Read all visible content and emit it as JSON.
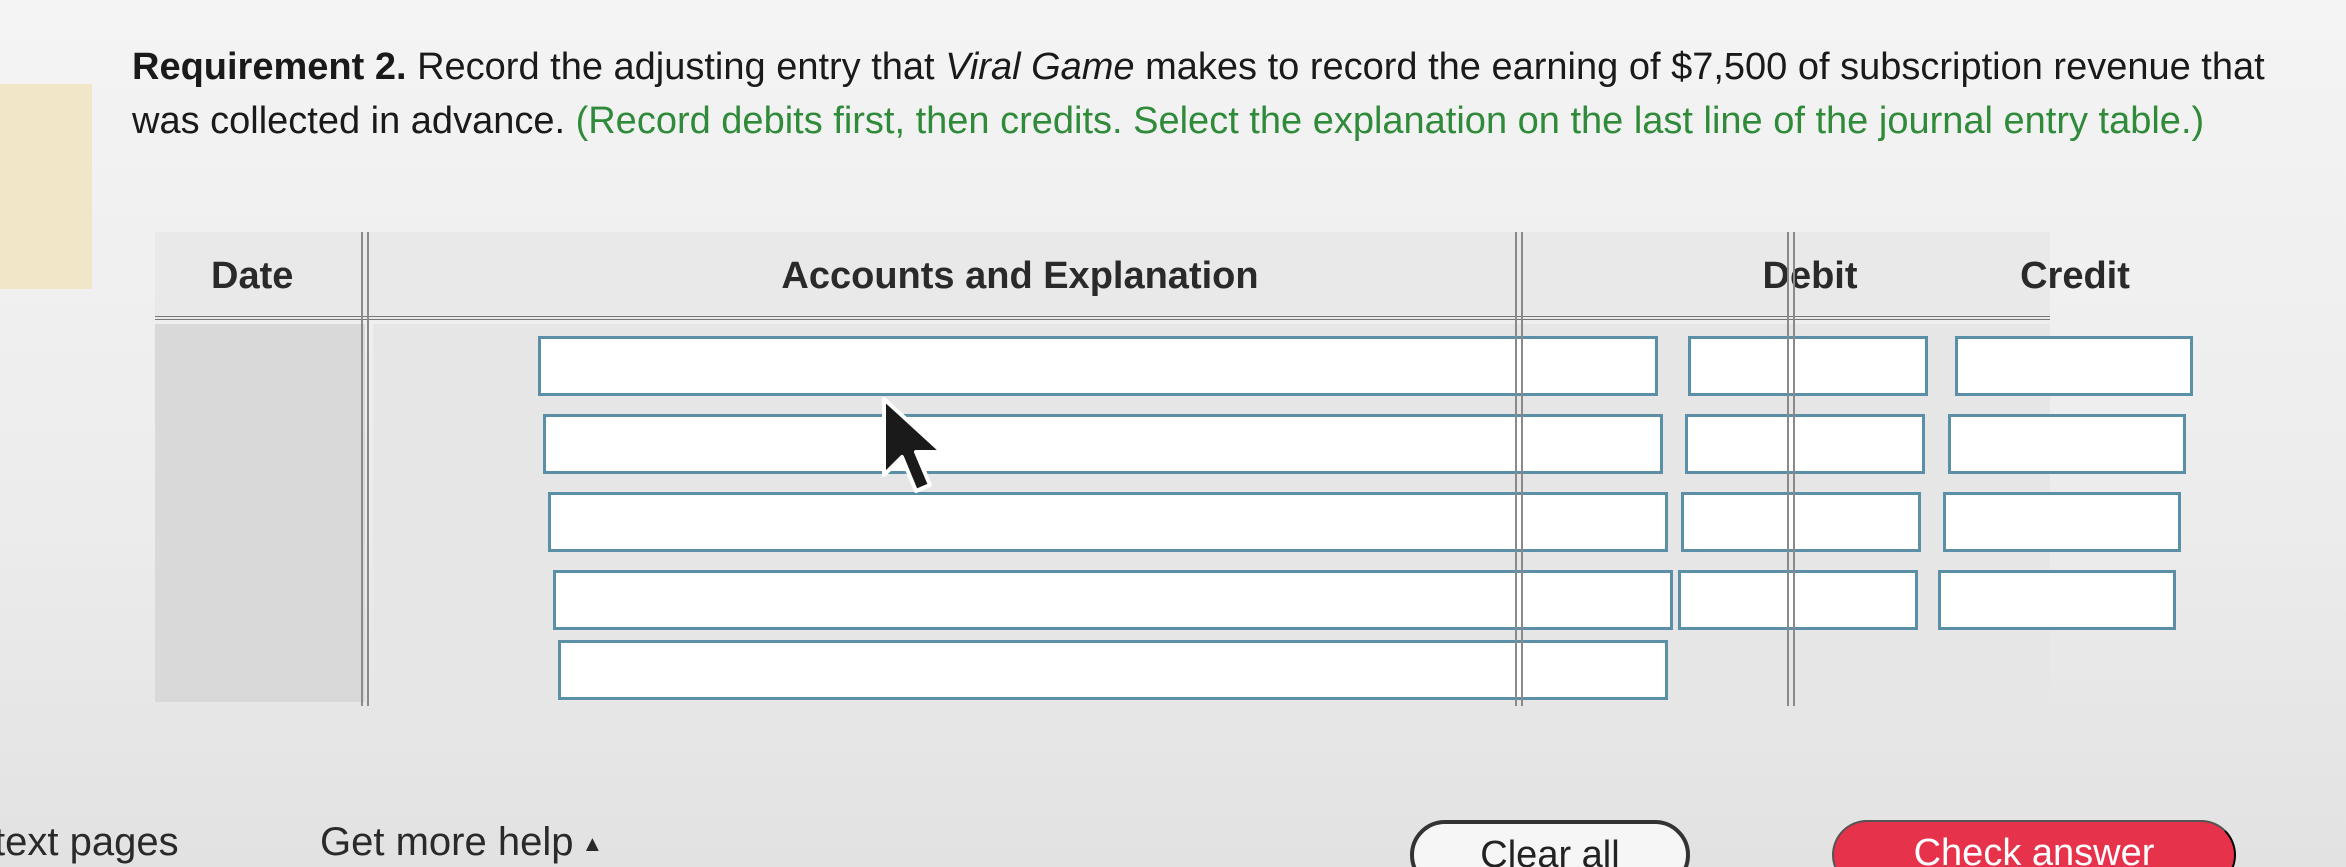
{
  "question": {
    "label": "Requirement 2.",
    "text_before": " Record the adjusting entry that ",
    "company": "Viral Game",
    "text_after": " makes to record the earning of $7,500 of subscription revenue that was collected in advance.",
    "hint": " (Record debits first, then credits. Select the explanation on the last line of the journal entry table.)"
  },
  "journal": {
    "columns": {
      "date": "Date",
      "accounts": "Accounts and Explanation",
      "debit": "Debit",
      "credit": "Credit"
    },
    "rows": [
      {
        "account": "",
        "debit": "",
        "credit": ""
      },
      {
        "account": "",
        "debit": "",
        "credit": ""
      },
      {
        "account": "",
        "debit": "",
        "credit": ""
      },
      {
        "account": "",
        "debit": "",
        "credit": ""
      },
      {
        "explanation": ""
      }
    ]
  },
  "footer": {
    "text_pages": "text pages",
    "get_more_help": "Get more help",
    "clear_all": "Clear all",
    "check_answer": "Check answer"
  },
  "colors": {
    "hint_green": "#2f8a3a",
    "input_border": "#5b8fa8",
    "check_button": "#e6324b"
  }
}
